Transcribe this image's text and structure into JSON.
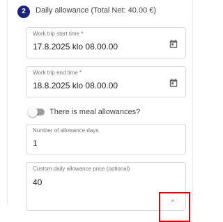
{
  "section": {
    "step_number": "2",
    "title": "Daily allowance (Total Net: 40.00 €)"
  },
  "fields": {
    "start_time": {
      "label": "Work trip start time *",
      "value": "17.8.2025 klo 08.00.00"
    },
    "end_time": {
      "label": "Work trip end time *",
      "value": "18.8.2025 klo 08.00.00"
    },
    "allowance_days": {
      "label": "Number of allowance days",
      "value": "1"
    },
    "custom_price": {
      "label": "Custom daily allowance price (optional)",
      "value": "40"
    }
  },
  "meal_toggle": {
    "label": "There is meal allowances?",
    "checked": false
  },
  "icons": {
    "calendar": "calendar-icon",
    "chevron": "chevron-up-icon"
  },
  "colors": {
    "badge": "#1a237e",
    "highlight": "#e00000",
    "toggle_track": "#9e9e9e"
  }
}
